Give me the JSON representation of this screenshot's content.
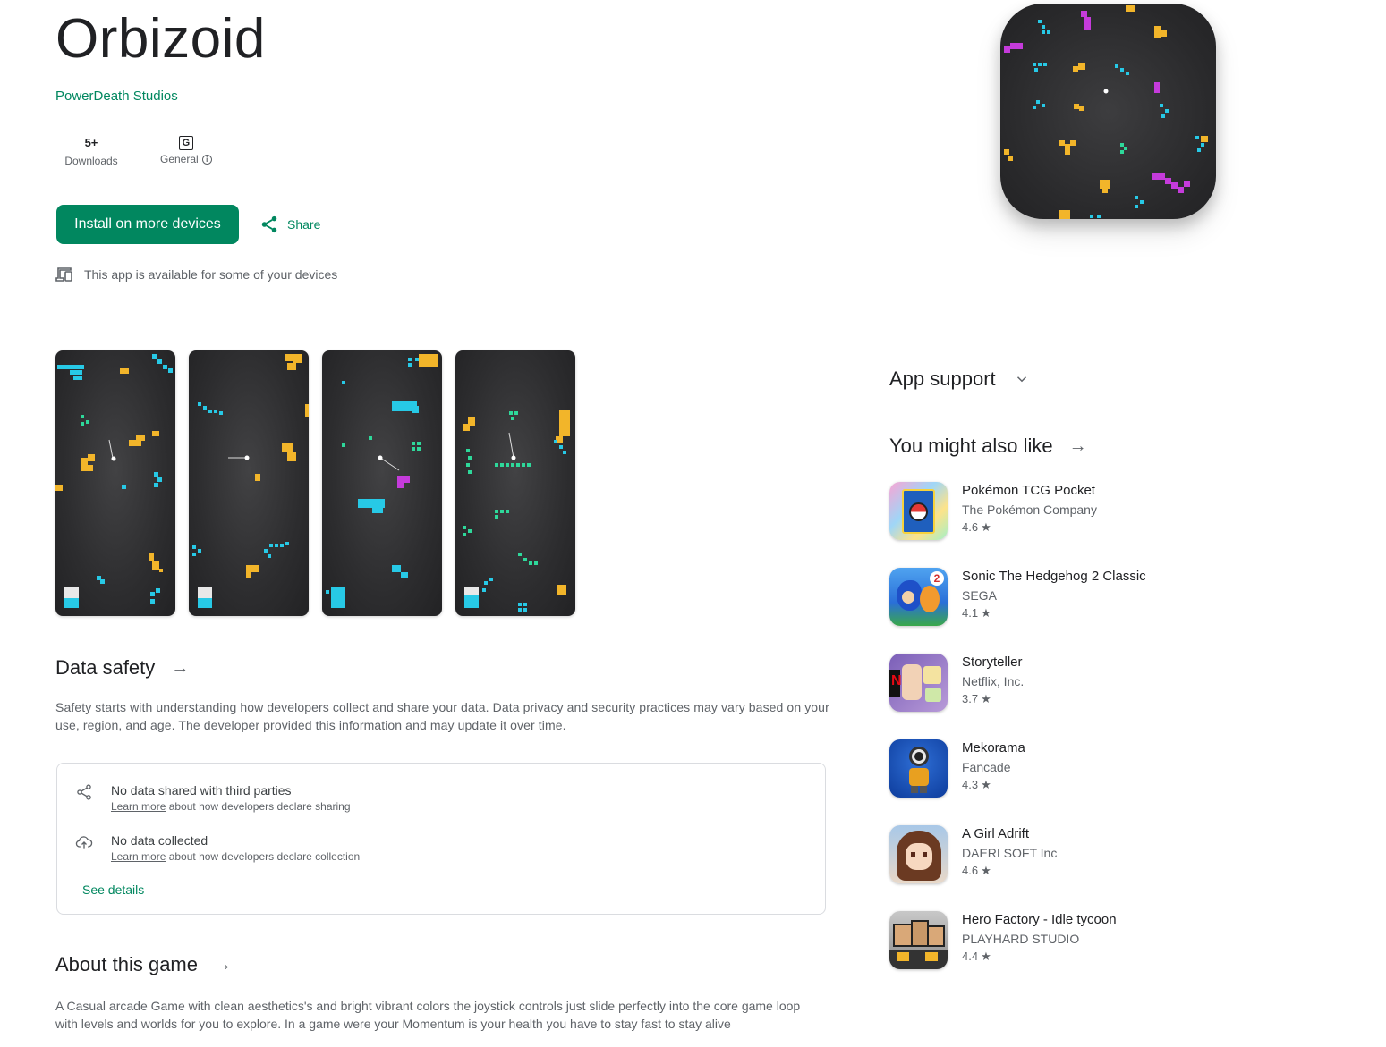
{
  "app": {
    "title": "Orbizoid",
    "developer": "PowerDeath Studios",
    "downloads_value": "5+",
    "downloads_label": "Downloads",
    "rating_badge": "G",
    "content_rating_label": "General",
    "install_label": "Install on more devices",
    "share_label": "Share",
    "availability_text": "This app is available for some of your devices"
  },
  "data_safety": {
    "title": "Data safety",
    "description": "Safety starts with understanding how developers collect and share your data. Data privacy and security practices may vary based on your use, region, and age. The developer provided this information and may update it over time.",
    "items": [
      {
        "main": "No data shared with third parties",
        "link": "Learn more",
        "sub": " about how developers declare sharing"
      },
      {
        "main": "No data collected",
        "link": "Learn more",
        "sub": " about how developers declare collection"
      }
    ],
    "see_details": "See details"
  },
  "about": {
    "title": "About this game",
    "description": "A Casual arcade Game with clean aesthetics's and bright vibrant colors the joystick controls just slide perfectly into the core game loop with levels and worlds for you to explore. In a game were your Momentum is your health you have to stay fast to stay alive"
  },
  "sidebar": {
    "support_title": "App support",
    "similar_title": "You might also like",
    "similar": [
      {
        "name": "Pokémon TCG Pocket",
        "developer": "The Pokémon Company",
        "rating": "4.6"
      },
      {
        "name": "Sonic The Hedgehog 2 Classic",
        "developer": "SEGA",
        "rating": "4.1"
      },
      {
        "name": "Storyteller",
        "developer": "Netflix, Inc.",
        "rating": "3.7"
      },
      {
        "name": "Mekorama",
        "developer": "Fancade",
        "rating": "4.3"
      },
      {
        "name": "A Girl Adrift",
        "developer": "DAERI SOFT Inc",
        "rating": "4.6"
      },
      {
        "name": "Hero Factory - Idle tycoon",
        "developer": "PLAYHARD STUDIO",
        "rating": "4.4"
      }
    ]
  },
  "colors": {
    "accent": "#01875f",
    "text_primary": "#202124",
    "text_secondary": "#5f6368",
    "block_cyan": "#27c9e6",
    "block_yellow": "#f2b52a",
    "block_magenta": "#c53bdb",
    "block_green": "#2ed89a"
  },
  "icons": [
    "share-icon",
    "devices-icon",
    "chevron-down-icon",
    "arrow-right-icon",
    "cloud-upload-icon",
    "star-icon",
    "info-icon"
  ]
}
